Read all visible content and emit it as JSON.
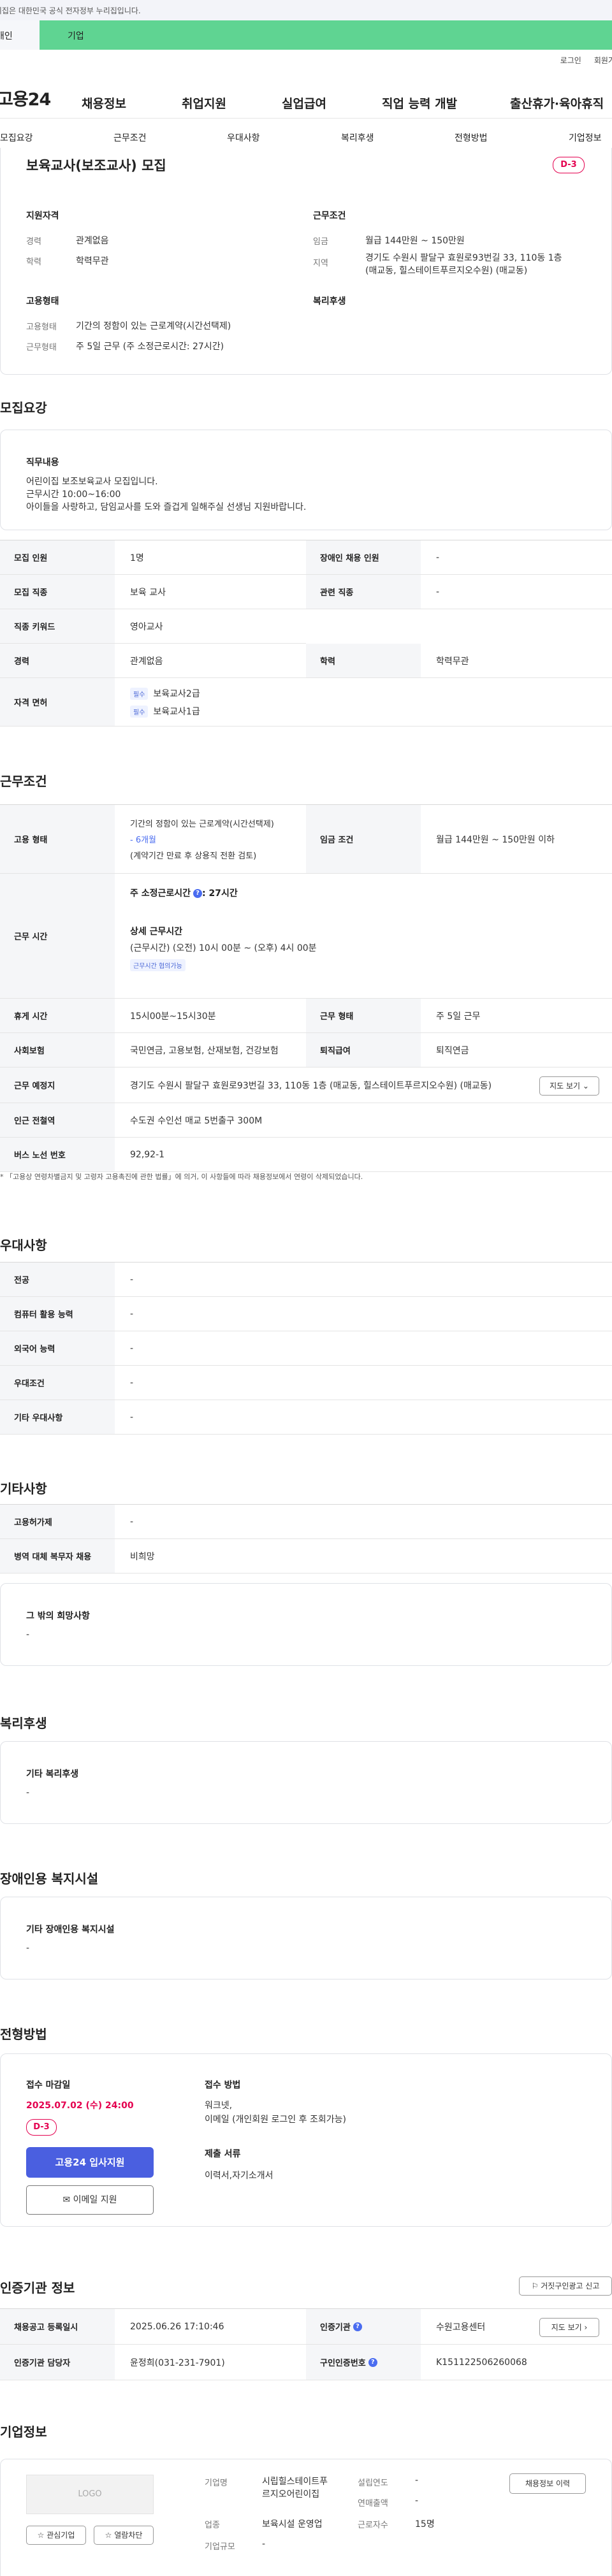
{
  "header": {
    "gov_notice": "이 누리집은 대한민국 공식 전자정부 누리집입니다.",
    "user_type_individual": "개인",
    "user_type_company": "기업",
    "login": "로그인",
    "signup": "회원가입",
    "logo": "고용24",
    "nav": [
      "채용정보",
      "취업지원",
      "실업급여",
      "직업 능력 개발",
      "출산휴가·육아휴직"
    ]
  },
  "tabs": [
    "모집요강",
    "근무조건",
    "우대사항",
    "복리후생",
    "전형방법",
    "기업정보"
  ],
  "summary": {
    "title": "보육교사(보조교사) 모집",
    "dday": "D-3",
    "qual_title": "지원자격",
    "career_label": "경력",
    "career": "관계없음",
    "edu_label": "학력",
    "edu": "학력무관",
    "emp_title": "고용형태",
    "emp_type_label": "고용형태",
    "emp_type": "기간의 정함이 있는 근로계약(시간선택제)",
    "work_type_label": "근무형태",
    "work_type": "주 5일 근무 (주 소정근로시간: 27시간)",
    "cond_title": "근무조건",
    "wage_label": "임금",
    "wage": "월급 144만원 ~ 150만원",
    "region_label": "지역",
    "region_1": "경기도 수원시 팔달구 효원로93번길 33, 110동 1층",
    "region_2": "(매교동, 힐스테이트푸르지오수원) (매교동)",
    "welfare_title": "복리후생"
  },
  "recruit": {
    "section": "모집요강",
    "duty_title": "직무내용",
    "duty_1": "어린이집 보조보육교사 모집입니다.",
    "duty_2": "근무시간 10:00~16:00",
    "duty_3": "아이들을 사랑하고, 담임교사를 도와 즐겁게 일해주실 선생님 지원바랍니다.",
    "count_label": "모집 인원",
    "count": "1명",
    "disabled_label": "장애인 채용 인원",
    "disabled": "-",
    "job_label": "모집 직종",
    "job": "보육 교사",
    "related_label": "관련 직종",
    "related": "-",
    "keyword_label": "직종 키워드",
    "keyword": "영아교사",
    "career_label": "경력",
    "career": "관계없음",
    "edu_label": "학력",
    "edu": "학력무관",
    "license_label": "자격 면허",
    "license_tag": "필수",
    "license_1": "보육교사2급",
    "license_2": "보육교사1급"
  },
  "conditions": {
    "section": "근무조건",
    "emp_label": "고용 형태",
    "emp_1": "기간의 정함이 있는 근로계약(시간선택제)",
    "emp_2": "- 6개월",
    "emp_3": "(계약기간 만료 후 상용직 전환 검토)",
    "wage_label": "임금 조건",
    "wage": "월급 144만원 ~ 150만원 이하",
    "hours_label": "근무 시간",
    "hours_weekly": "주 소정근로시간",
    "hours_weekly_val": ": 27시간",
    "hours_detail_title": "상세 근무시간",
    "hours_detail": "(근무시간) (오전) 10시 00분 ~ (오후) 4시 00분",
    "hours_tag": "근무시간 협의가능",
    "break_label": "휴게 시간",
    "break": "15시00분~15시30분",
    "form_label": "근무 형태",
    "form": "주 5일 근무",
    "insurance_label": "사회보험",
    "insurance": "국민연금, 고용보험, 산재보험, 건강보험",
    "severance_label": "퇴직급여",
    "severance": "퇴직연금",
    "location_label": "근무 예정지",
    "location": "경기도 수원시 팔달구 효원로93번길 33, 110동 1층 (매교동, 힐스테이트푸르지오수원) (매교동)",
    "map_btn": "지도 보기",
    "subway_label": "인근 전철역",
    "subway": "수도권 수인선 매교 5번출구 300M",
    "bus_label": "버스 노선 번호",
    "bus": "92,92-1",
    "notice": "* 「고용상 연령차별금지 및 고령자 고용촉진에 관한 법률」에 의거, 이 사항들에 따라 채용정보에서 연령이 삭제되었습니다."
  },
  "preference": {
    "section": "우대사항",
    "rows": [
      {
        "label": "전공",
        "value": "-"
      },
      {
        "label": "컴퓨터 활용 능력",
        "value": "-"
      },
      {
        "label": "외국어 능력",
        "value": "-"
      },
      {
        "label": "우대조건",
        "value": "-"
      },
      {
        "label": "기타 우대사항",
        "value": "-"
      }
    ]
  },
  "etc": {
    "section": "기타사항",
    "perm_label": "고용허가제",
    "perm": "-",
    "military_label": "병역 대체 복무자 채용",
    "military": "비희망",
    "other_title": "그 밖의 희망사항",
    "other": "-"
  },
  "welfare": {
    "section": "복리후생",
    "title": "기타 복리후생",
    "value": "-"
  },
  "disability": {
    "section": "장애인용 복지시설",
    "title": "기타 장애인용 복지시설",
    "value": "-"
  },
  "selection": {
    "section": "전형방법",
    "deadline_title": "접수 마감일",
    "deadline": "2025.07.02 (수) 24:00",
    "dday": "D-3",
    "apply_btn": "고용24 입사지원",
    "email_btn": "이메일 지원",
    "method_title": "접수 방법",
    "method_1": "워크넷,",
    "method_2": "이메일 (개인회원 로그인 후 조회가능)",
    "docs_title": "제출 서류",
    "docs": "이력서,자기소개서"
  },
  "agency": {
    "section": "인증기관 정보",
    "report_btn": "거짓구인광고 신고",
    "reg_label": "채용공고 등록일시",
    "reg": "2025.06.26 17:10:46",
    "org_label": "인증기관",
    "org": "수원고용센터",
    "map_btn": "지도 보기",
    "manager_label": "인증기관 담당자",
    "manager": "윤정희(031-231-7901)",
    "num_label": "구인인증번호",
    "num": "K151122506260068"
  },
  "company": {
    "section": "기업정보",
    "logo": "LOGO",
    "fav_btn": "관심기업",
    "block_btn": "열람차단",
    "name_label": "기업명",
    "name_1": "시립힐스테이트푸",
    "name_2": "르지오어린이집",
    "founded_label": "설립연도",
    "founded": "-",
    "sales_label": "연매출액",
    "sales": "-",
    "industry_label": "업종",
    "industry": "보육시설 운영업",
    "employees_label": "근로자수",
    "employees": "15명",
    "scale_label": "기업규모",
    "scale": "-",
    "history_btn": "채용정보 이력"
  }
}
